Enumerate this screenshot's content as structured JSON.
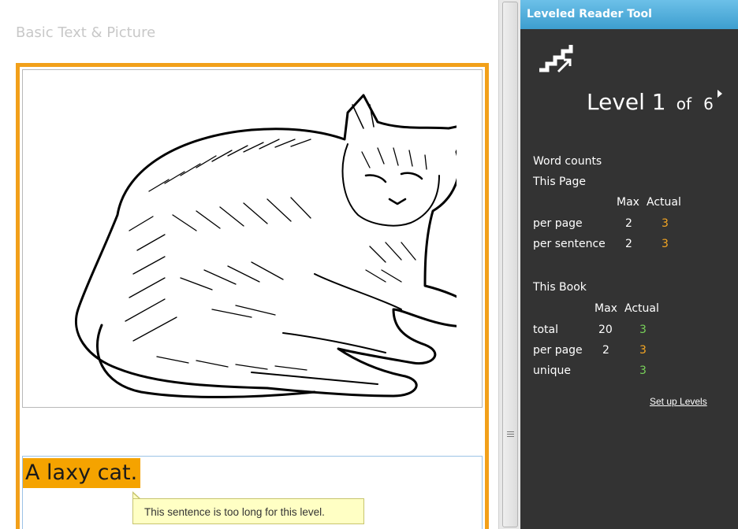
{
  "page": {
    "title": "Basic Text & Picture",
    "sentence": "A laxy cat.",
    "tooltip": "This sentence is too long for this level."
  },
  "tool": {
    "title": "Leveled Reader Tool",
    "level_label": "Level 1",
    "of_label": "of",
    "level_total": "6",
    "word_counts_heading": "Word counts",
    "this_page": {
      "heading": "This Page",
      "max_header": "Max",
      "actual_header": "Actual",
      "rows": [
        {
          "label": "per page",
          "max": "2",
          "actual": "3",
          "status": "over"
        },
        {
          "label": "per sentence",
          "max": "2",
          "actual": "3",
          "status": "over"
        }
      ]
    },
    "this_book": {
      "heading": "This Book",
      "max_header": "Max",
      "actual_header": "Actual",
      "rows": [
        {
          "label": "total",
          "max": "20",
          "actual": "3",
          "status": "ok"
        },
        {
          "label": "per page",
          "max": "2",
          "actual": "3",
          "status": "over"
        },
        {
          "label": "unique",
          "max": "",
          "actual": "3",
          "status": "ok"
        }
      ]
    },
    "setup_link": "Set up Levels"
  },
  "colors": {
    "frame": "#f2a01a",
    "highlight": "#f5a300",
    "panel_bg": "#333333",
    "header_blue": "#4fa9d8",
    "over_limit": "#f5a623",
    "within_limit": "#78d25a",
    "tooltip_bg": "#ffffc4"
  },
  "icons": [
    "stairs-level-icon",
    "next-level-arrow-icon",
    "cat-illustration"
  ]
}
